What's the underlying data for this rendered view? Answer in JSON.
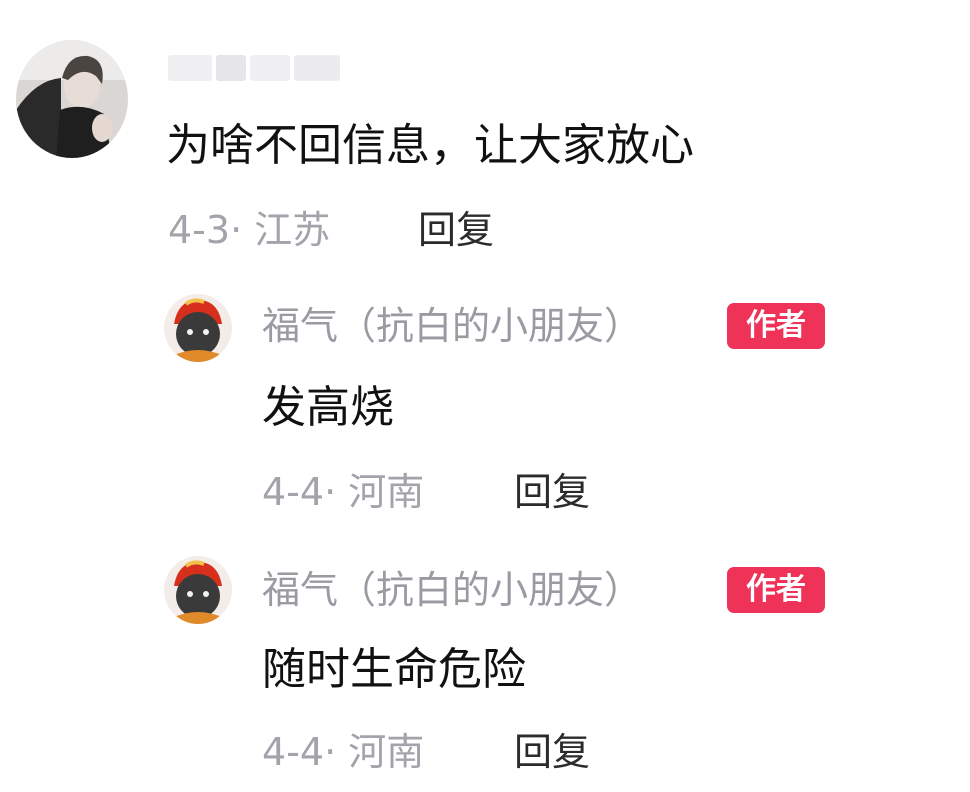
{
  "comment": {
    "username": "",
    "text": "为啥不回信息，让大家放心",
    "meta": "4-3· 江苏",
    "reply_label": "回复"
  },
  "replies": [
    {
      "username": "福气（抗白的小朋友）",
      "badge": "作者",
      "text": "发高烧",
      "meta": "4-4· 河南",
      "reply_label": "回复"
    },
    {
      "username": "福气（抗白的小朋友）",
      "badge": "作者",
      "text": "随时生命危险",
      "meta": "4-4· 河南",
      "reply_label": "回复"
    }
  ],
  "colors": {
    "badge": "#ef3358",
    "meta": "#a3a3ab",
    "username": "#9a9aa2"
  }
}
